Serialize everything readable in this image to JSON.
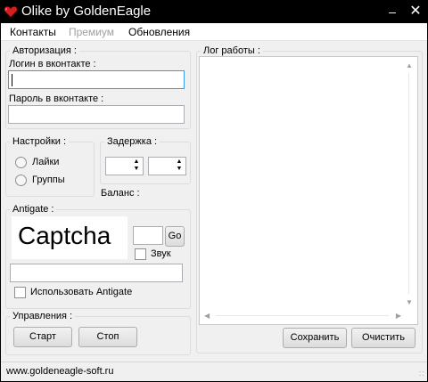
{
  "window": {
    "title": "Olike by GoldenEagle",
    "min_glyph": "‒",
    "close_glyph": "✕"
  },
  "menu": {
    "contacts": "Контакты",
    "premium": "Премиум",
    "updates": "Обновления"
  },
  "auth": {
    "legend": "Авторизация :",
    "login_label": "Логин в вконтакте :",
    "login_value": "",
    "password_label": "Пароль в вконтакте :",
    "password_value": ""
  },
  "settings": {
    "legend": "Настройки :",
    "likes": "Лайки",
    "groups": "Группы"
  },
  "delay": {
    "legend": "Задержка :",
    "spin1_value": "",
    "spin2_value": ""
  },
  "balance": {
    "label": "Баланс :",
    "value": ""
  },
  "antigate": {
    "legend": "Antigate :",
    "captcha_text": "Captcha",
    "code_value": "",
    "go_button": "Go",
    "sound_label": "Звук",
    "key_value": "",
    "use_label": "Использовать Antigate"
  },
  "control": {
    "legend": "Управления :",
    "start_button": "Старт",
    "stop_button": "Стоп"
  },
  "log": {
    "legend": "Лог работы :",
    "save_button": "Сохранить",
    "clear_button": "Очистить"
  },
  "status": {
    "url": "www.goldeneagle-soft.ru"
  },
  "colors": {
    "titlebar": "#000000",
    "window_bg": "#f0f0f0",
    "focus_border": "#3399ff"
  }
}
